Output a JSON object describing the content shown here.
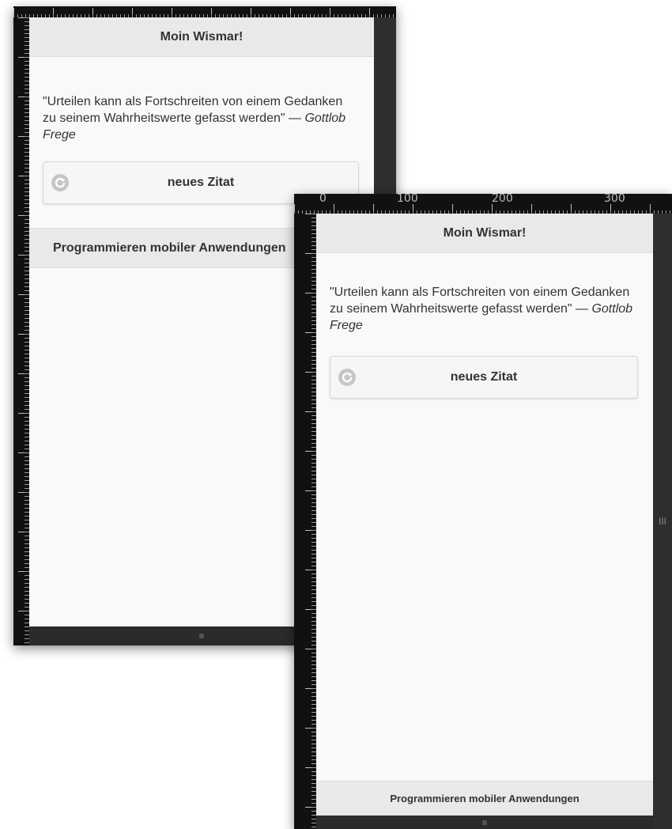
{
  "preview_back": {
    "header_title": "Moin Wismar!",
    "quote_text": "\"Urteilen kann als Fortschreiten von einem Gedanken zu seinem Wahrheitswerte gefasst werden\" —",
    "quote_author": "Gottlob Frege",
    "button_label": "neues Zitat",
    "button_icon": "refresh-icon",
    "footer_label": "Programmieren mobiler Anwendungen",
    "resize_handle": "≡"
  },
  "preview_front": {
    "ruler_labels": [
      "0",
      "100",
      "200",
      "300"
    ],
    "header_title": "Moin Wismar!",
    "quote_text": "\"Urteilen kann als Fortschreiten von einem Gedanken zu seinem Wahrheitswerte gefasst werden\" —",
    "quote_author": "Gottlob Frege",
    "button_label": "neues Zitat",
    "button_icon": "refresh-icon",
    "footer_label": "Programmieren mobiler Anwendungen",
    "resize_handle_bottom": "≡",
    "resize_handle_side": "III"
  },
  "colors": {
    "header_bg": "#e9e9e9",
    "page_bg": "#f9f9f9",
    "frame_bg": "#1a1a1a"
  }
}
